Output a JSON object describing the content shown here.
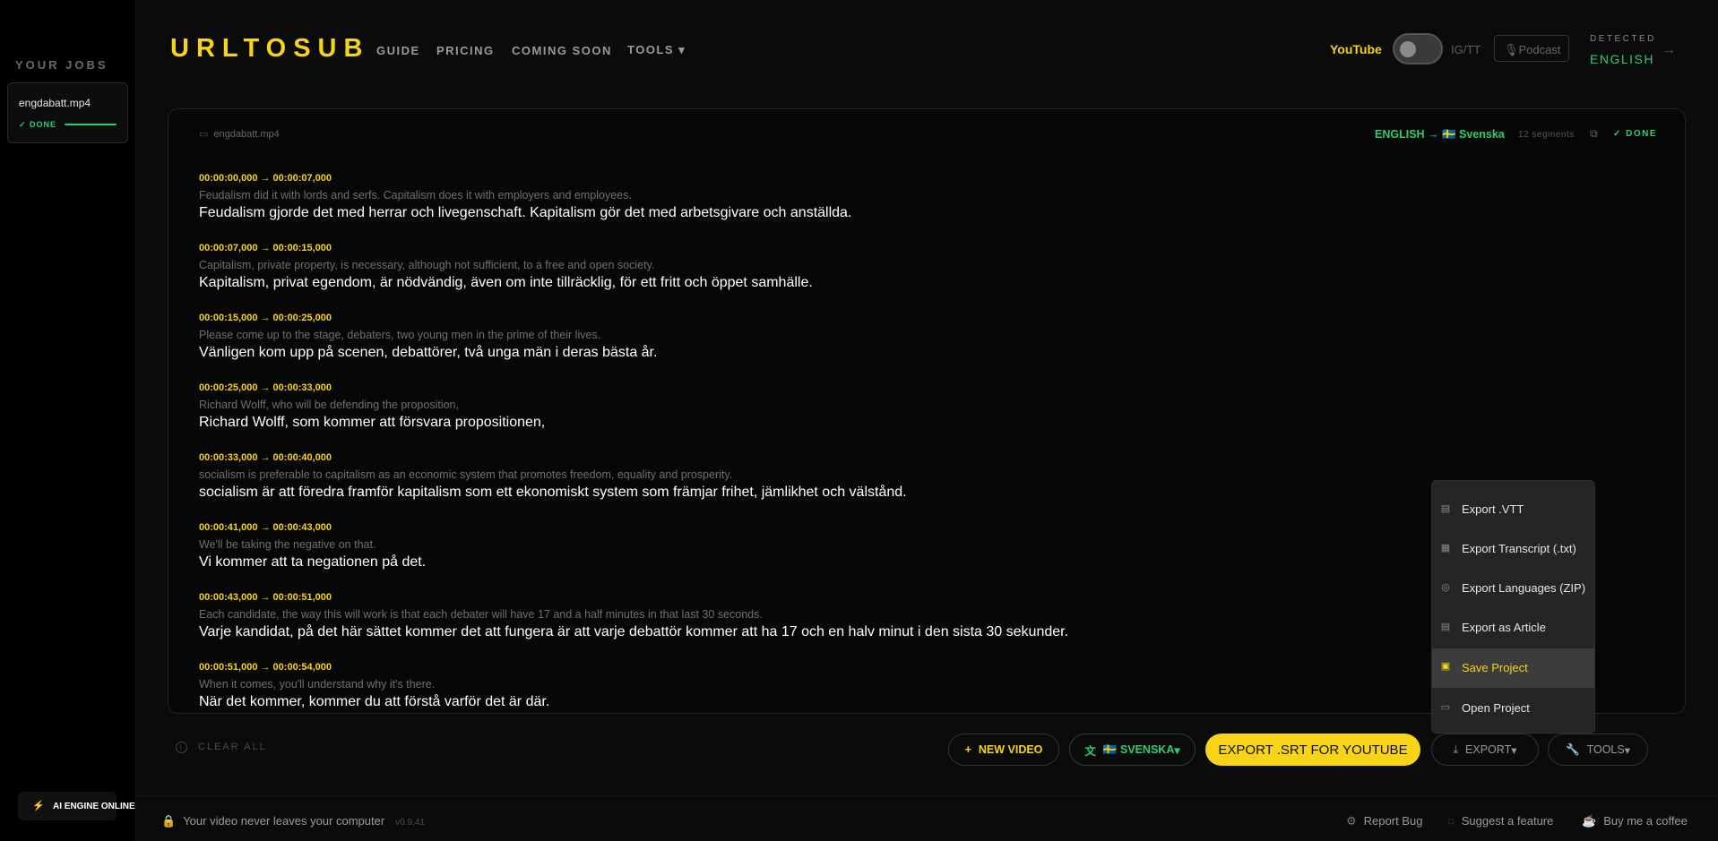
{
  "sidebar": {
    "title": "YOUR JOBS",
    "jobs": [
      {
        "name": "engdabatt.mp4",
        "status": "✓ DONE",
        "progress": 1.0
      }
    ],
    "engine_status": "AI ENGINE ONLINE"
  },
  "header": {
    "logo": "URLTOSUB",
    "nav": [
      "GUIDE",
      "PRICING",
      "COMING SOON",
      "TOOLS ▾"
    ],
    "source_toggle": {
      "left_label": "YouTube",
      "right_label": "IG/TT",
      "selected": "YouTube"
    },
    "podcast_label": "Podcast",
    "detected_label": "DETECTED",
    "detected_value": "ENGLISH"
  },
  "panel": {
    "filename": "engdabatt.mp4",
    "language_pair": "ENGLISH → 🇸🇪 Svenska",
    "segment_count": "12 segments",
    "status": "✓ DONE",
    "segments": [
      {
        "time": "00:00:00,000 → 00:00:07,000",
        "source": "Feudalism did it with lords and serfs. Capitalism does it with employers and employees.",
        "translation": "Feudalism gjorde det med herrar och livegenschaft. Kapitalism gör det med arbetsgivare och anställda."
      },
      {
        "time": "00:00:07,000 → 00:00:15,000",
        "source": "Capitalism, private property, is necessary, although not sufficient, to a free and open society.",
        "translation": "Kapitalism, privat egendom, är nödvändig, även om inte tillräcklig, för ett fritt och öppet samhälle."
      },
      {
        "time": "00:00:15,000 → 00:00:25,000",
        "source": "Please come up to the stage, debaters, two young men in the prime of their lives.",
        "translation": "Vänligen kom upp på scenen, debattörer, två unga män i deras bästa år."
      },
      {
        "time": "00:00:25,000 → 00:00:33,000",
        "source": "Richard Wolff, who will be defending the proposition,",
        "translation": "Richard Wolff, som kommer att försvara propositionen,"
      },
      {
        "time": "00:00:33,000 → 00:00:40,000",
        "source": "socialism is preferable to capitalism as an economic system that promotes freedom, equality and prosperity.",
        "translation": "socialism är att föredra framför kapitalism som ett ekonomiskt system som främjar frihet, jämlikhet och välstånd."
      },
      {
        "time": "00:00:41,000 → 00:00:43,000",
        "source": "We'll be taking the negative on that.",
        "translation": "Vi kommer att ta negationen på det."
      },
      {
        "time": "00:00:43,000 → 00:00:51,000",
        "source": "Each candidate, the way this will work is that each debater will have 17 and a half minutes in that last 30 seconds.",
        "translation": "Varje kandidat, på det här sättet kommer det att fungera är att varje debattör kommer att ha 17 och en halv minut i den sista 30 sekunder."
      },
      {
        "time": "00:00:51,000 → 00:00:54,000",
        "source": "When it comes, you'll understand why it's there.",
        "translation": "När det kommer, kommer du att förstå varför det är där."
      }
    ]
  },
  "actions": {
    "clear_all": "CLEAR ALL",
    "new_video": "NEW VIDEO",
    "language": "🇸🇪 SVENSKA",
    "export_srt": "EXPORT .SRT FOR YOUTUBE",
    "export": "EXPORT",
    "tools": "TOOLS"
  },
  "export_menu": {
    "items": [
      {
        "label": "Export .VTT",
        "icon": "vtt-icon"
      },
      {
        "label": "Export Transcript (.txt)",
        "icon": "document-icon"
      },
      {
        "label": "Export Languages (ZIP)",
        "icon": "globe-icon"
      },
      {
        "label": "Export as Article",
        "icon": "article-icon"
      },
      {
        "label": "Save Project",
        "icon": "save-icon",
        "active": true
      },
      {
        "label": "Open Project",
        "icon": "folder-icon"
      }
    ]
  },
  "footer": {
    "privacy": "Your video never leaves your computer",
    "version": "v0.9.41",
    "report_bug": "Report Bug",
    "suggest": "Suggest a feature",
    "coffee": "Buy me a coffee"
  },
  "colors": {
    "accent": "#f7d417",
    "success": "#2ecc71",
    "background": "#0b0b0b"
  }
}
